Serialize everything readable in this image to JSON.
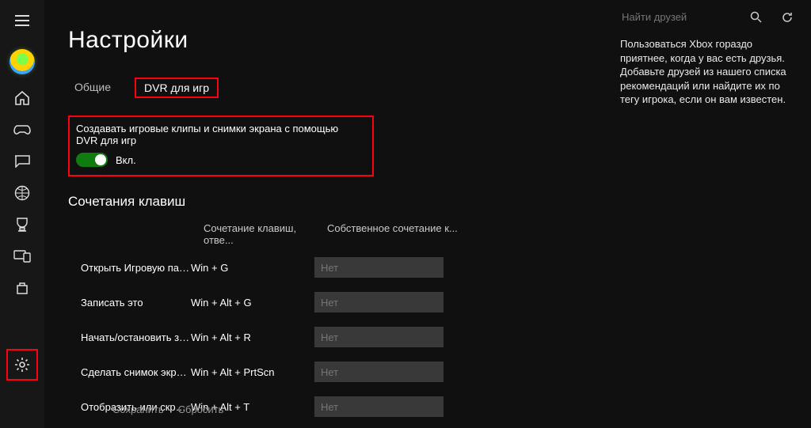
{
  "sidebar": {
    "items": [
      {
        "name": "hamburger-icon"
      },
      {
        "name": "avatar"
      },
      {
        "name": "home-icon"
      },
      {
        "name": "controller-icon"
      },
      {
        "name": "chat-icon"
      },
      {
        "name": "globe-icon"
      },
      {
        "name": "trophy-icon"
      },
      {
        "name": "devices-icon"
      },
      {
        "name": "store-icon"
      }
    ],
    "settings_name": "settings-icon"
  },
  "page": {
    "title": "Настройки"
  },
  "tabs": {
    "general": "Общие",
    "dvr": "DVR для игр"
  },
  "dvr": {
    "label": "Создавать игровые клипы и снимки экрана с помощью DVR для игр",
    "state": "Вкл."
  },
  "shortcuts": {
    "heading": "Сочетания клавиш",
    "col_def": "Сочетание клавиш, отве...",
    "col_cust": "Собственное сочетание к...",
    "placeholder": "Нет",
    "rows": [
      {
        "action": "Открыть Игровую пан...",
        "def": "Win + G"
      },
      {
        "action": "Записать это",
        "def": "Win + Alt + G"
      },
      {
        "action": "Начать/остановить зап...",
        "def": "Win + Alt + R"
      },
      {
        "action": "Сделать снимок экрана",
        "def": "Win + Alt + PrtScn"
      },
      {
        "action": "Отобразить или скрыт...",
        "def": "Win + Alt + T"
      }
    ]
  },
  "footer": {
    "save": "Сохранить",
    "reset": "Сбросить"
  },
  "right": {
    "search_placeholder": "Найти друзей",
    "friends_text": "Пользоваться Xbox гораздо приятнее, когда у вас есть друзья. Добавьте друзей из нашего списка рекомендаций или найдите их по тегу игрока, если он вам известен."
  }
}
